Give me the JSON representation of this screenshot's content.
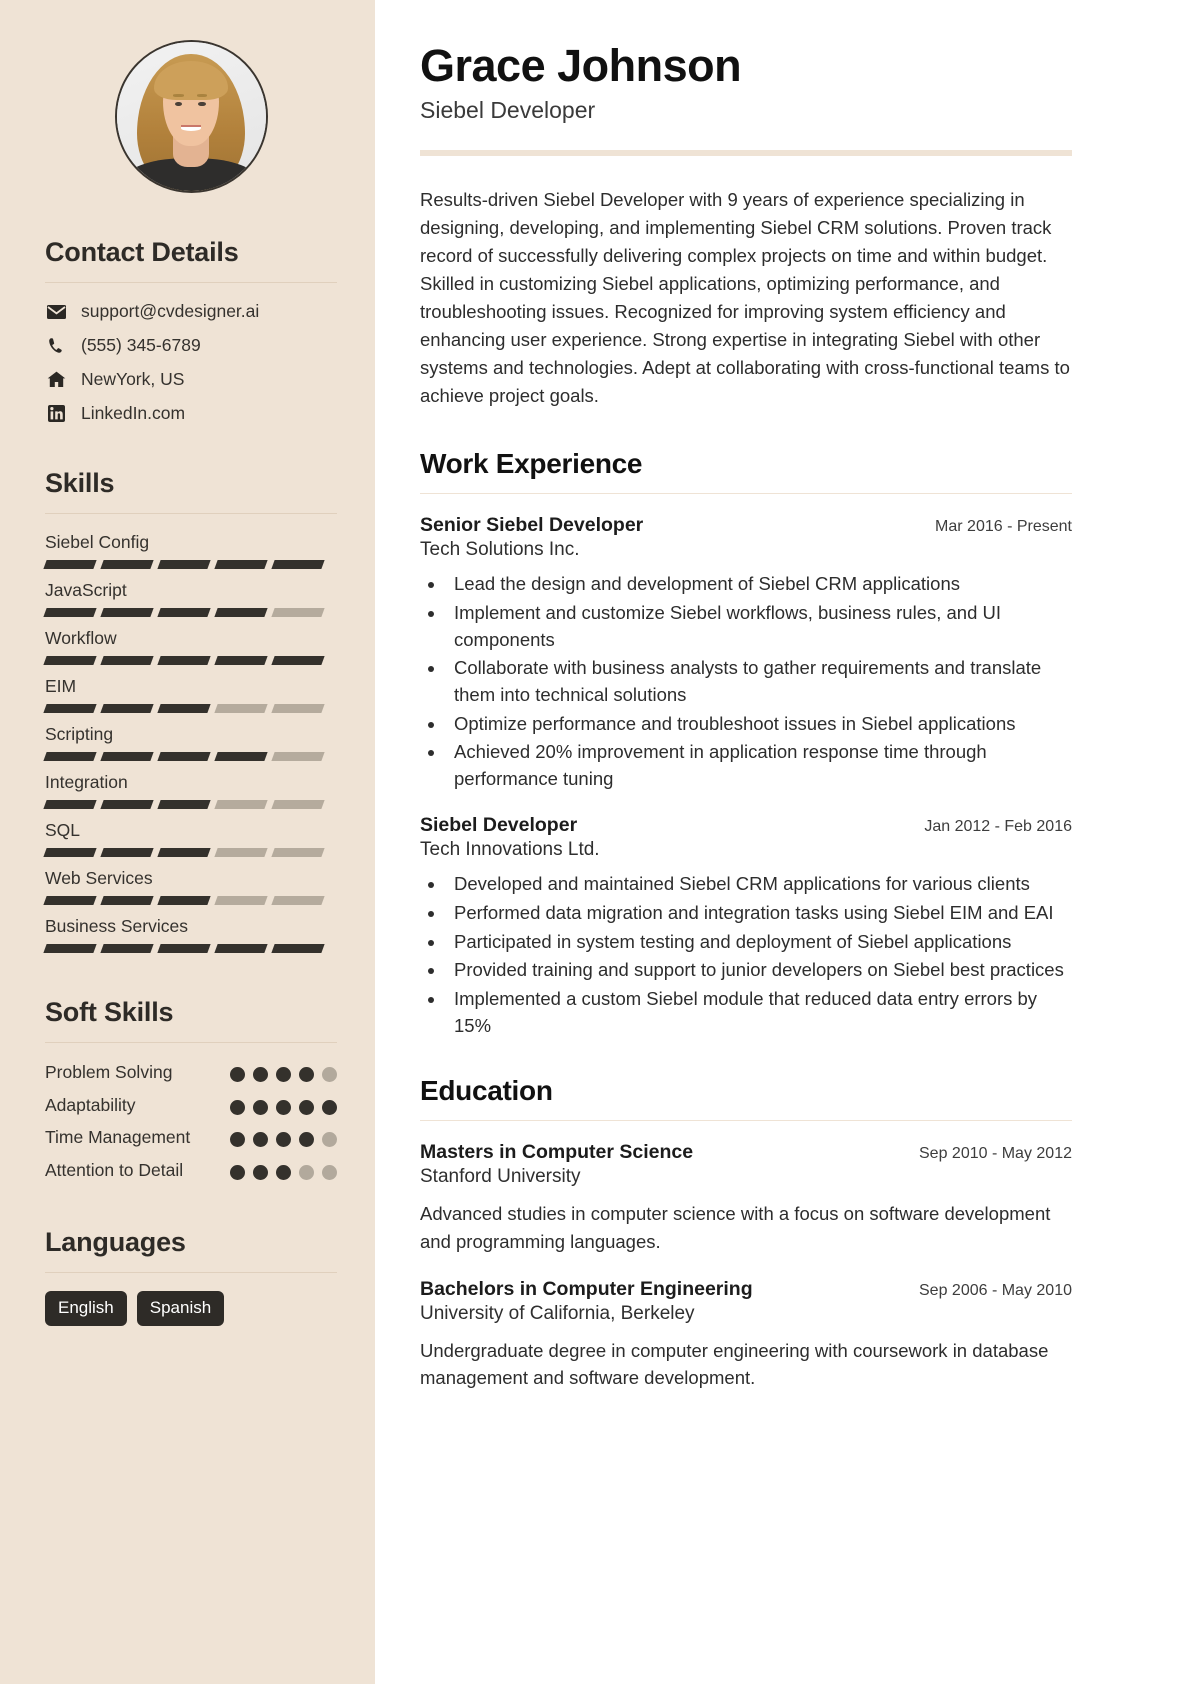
{
  "header": {
    "name": "Grace Johnson",
    "role": "Siebel Developer"
  },
  "summary": "Results-driven Siebel Developer with 9 years of experience specializing in designing, developing, and implementing Siebel CRM solutions. Proven track record of successfully delivering complex projects on time and within budget. Skilled in customizing Siebel applications, optimizing performance, and troubleshooting issues. Recognized for improving system efficiency and enhancing user experience. Strong expertise in integrating Siebel with other systems and technologies. Adept at collaborating with cross-functional teams to achieve project goals.",
  "sidebar": {
    "contact": {
      "heading": "Contact Details",
      "items": [
        {
          "icon": "envelope-icon",
          "value": "support@cvdesigner.ai"
        },
        {
          "icon": "phone-icon",
          "value": "(555) 345-6789"
        },
        {
          "icon": "home-icon",
          "value": "NewYork, US"
        },
        {
          "icon": "linkedin-icon",
          "value": "LinkedIn.com"
        }
      ]
    },
    "skills": {
      "heading": "Skills",
      "max": 5,
      "items": [
        {
          "name": "Siebel Config",
          "level": 5
        },
        {
          "name": "JavaScript",
          "level": 4
        },
        {
          "name": "Workflow",
          "level": 5
        },
        {
          "name": "EIM",
          "level": 3
        },
        {
          "name": "Scripting",
          "level": 4
        },
        {
          "name": "Integration",
          "level": 3
        },
        {
          "name": "SQL",
          "level": 3
        },
        {
          "name": "Web Services",
          "level": 3
        },
        {
          "name": "Business Services",
          "level": 5
        }
      ]
    },
    "soft_skills": {
      "heading": "Soft Skills",
      "max": 5,
      "items": [
        {
          "name": "Problem Solving",
          "level": 4
        },
        {
          "name": "Adaptability",
          "level": 5
        },
        {
          "name": "Time Management",
          "level": 4
        },
        {
          "name": "Attention to Detail",
          "level": 3
        }
      ]
    },
    "languages": {
      "heading": "Languages",
      "items": [
        "English",
        "Spanish"
      ]
    }
  },
  "work": {
    "heading": "Work Experience",
    "entries": [
      {
        "title": "Senior Siebel Developer",
        "org": "Tech Solutions Inc.",
        "date": "Mar 2016 - Present",
        "bullets": [
          "Lead the design and development of Siebel CRM applications",
          "Implement and customize Siebel workflows, business rules, and UI components",
          "Collaborate with business analysts to gather requirements and translate them into technical solutions",
          "Optimize performance and troubleshoot issues in Siebel applications",
          "Achieved 20% improvement in application response time through performance tuning"
        ]
      },
      {
        "title": "Siebel Developer",
        "org": "Tech Innovations Ltd.",
        "date": "Jan 2012 - Feb 2016",
        "bullets": [
          "Developed and maintained Siebel CRM applications for various clients",
          "Performed data migration and integration tasks using Siebel EIM and EAI",
          "Participated in system testing and deployment of Siebel applications",
          "Provided training and support to junior developers on Siebel best practices",
          "Implemented a custom Siebel module that reduced data entry errors by 15%"
        ]
      }
    ]
  },
  "education": {
    "heading": "Education",
    "entries": [
      {
        "title": "Masters in Computer Science",
        "org": "Stanford University",
        "date": "Sep 2010 - May 2012",
        "desc": "Advanced studies in computer science with a focus on software development and programming languages."
      },
      {
        "title": "Bachelors in Computer Engineering",
        "org": "University of California, Berkeley",
        "date": "Sep 2006 - May 2010",
        "desc": "Undergraduate degree in computer engineering with coursework in database management and software development."
      }
    ]
  },
  "colors": {
    "sidebar_bg": "#efe3d5",
    "ink": "#2e2b27",
    "bar_on": "#34312c",
    "bar_off": "#b5ab9d",
    "accent_rule": "#efe3d5"
  }
}
